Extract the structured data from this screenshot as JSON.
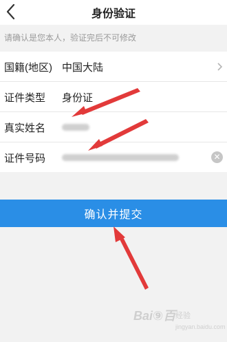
{
  "nav": {
    "title": "身份验证",
    "back_icon": "chevron-left-icon"
  },
  "hint": "请确认是您本人，验证完后不可修改",
  "form": {
    "rows": [
      {
        "label": "国籍(地区)",
        "value": "中国大陆",
        "has_chevron": true
      },
      {
        "label": "证件类型",
        "value": "身份证"
      },
      {
        "label": "真实姓名",
        "value": "",
        "masked": true
      },
      {
        "label": "证件号码",
        "value": "",
        "masked": true,
        "has_clear": true
      }
    ]
  },
  "submit": {
    "label": "确认并提交",
    "color": "#2a8ee6"
  },
  "annotation_color": "#e23a3a",
  "watermark": {
    "brand": "Bai⑨百",
    "sub": "经验",
    "url": "jingyan.baidu.com"
  }
}
